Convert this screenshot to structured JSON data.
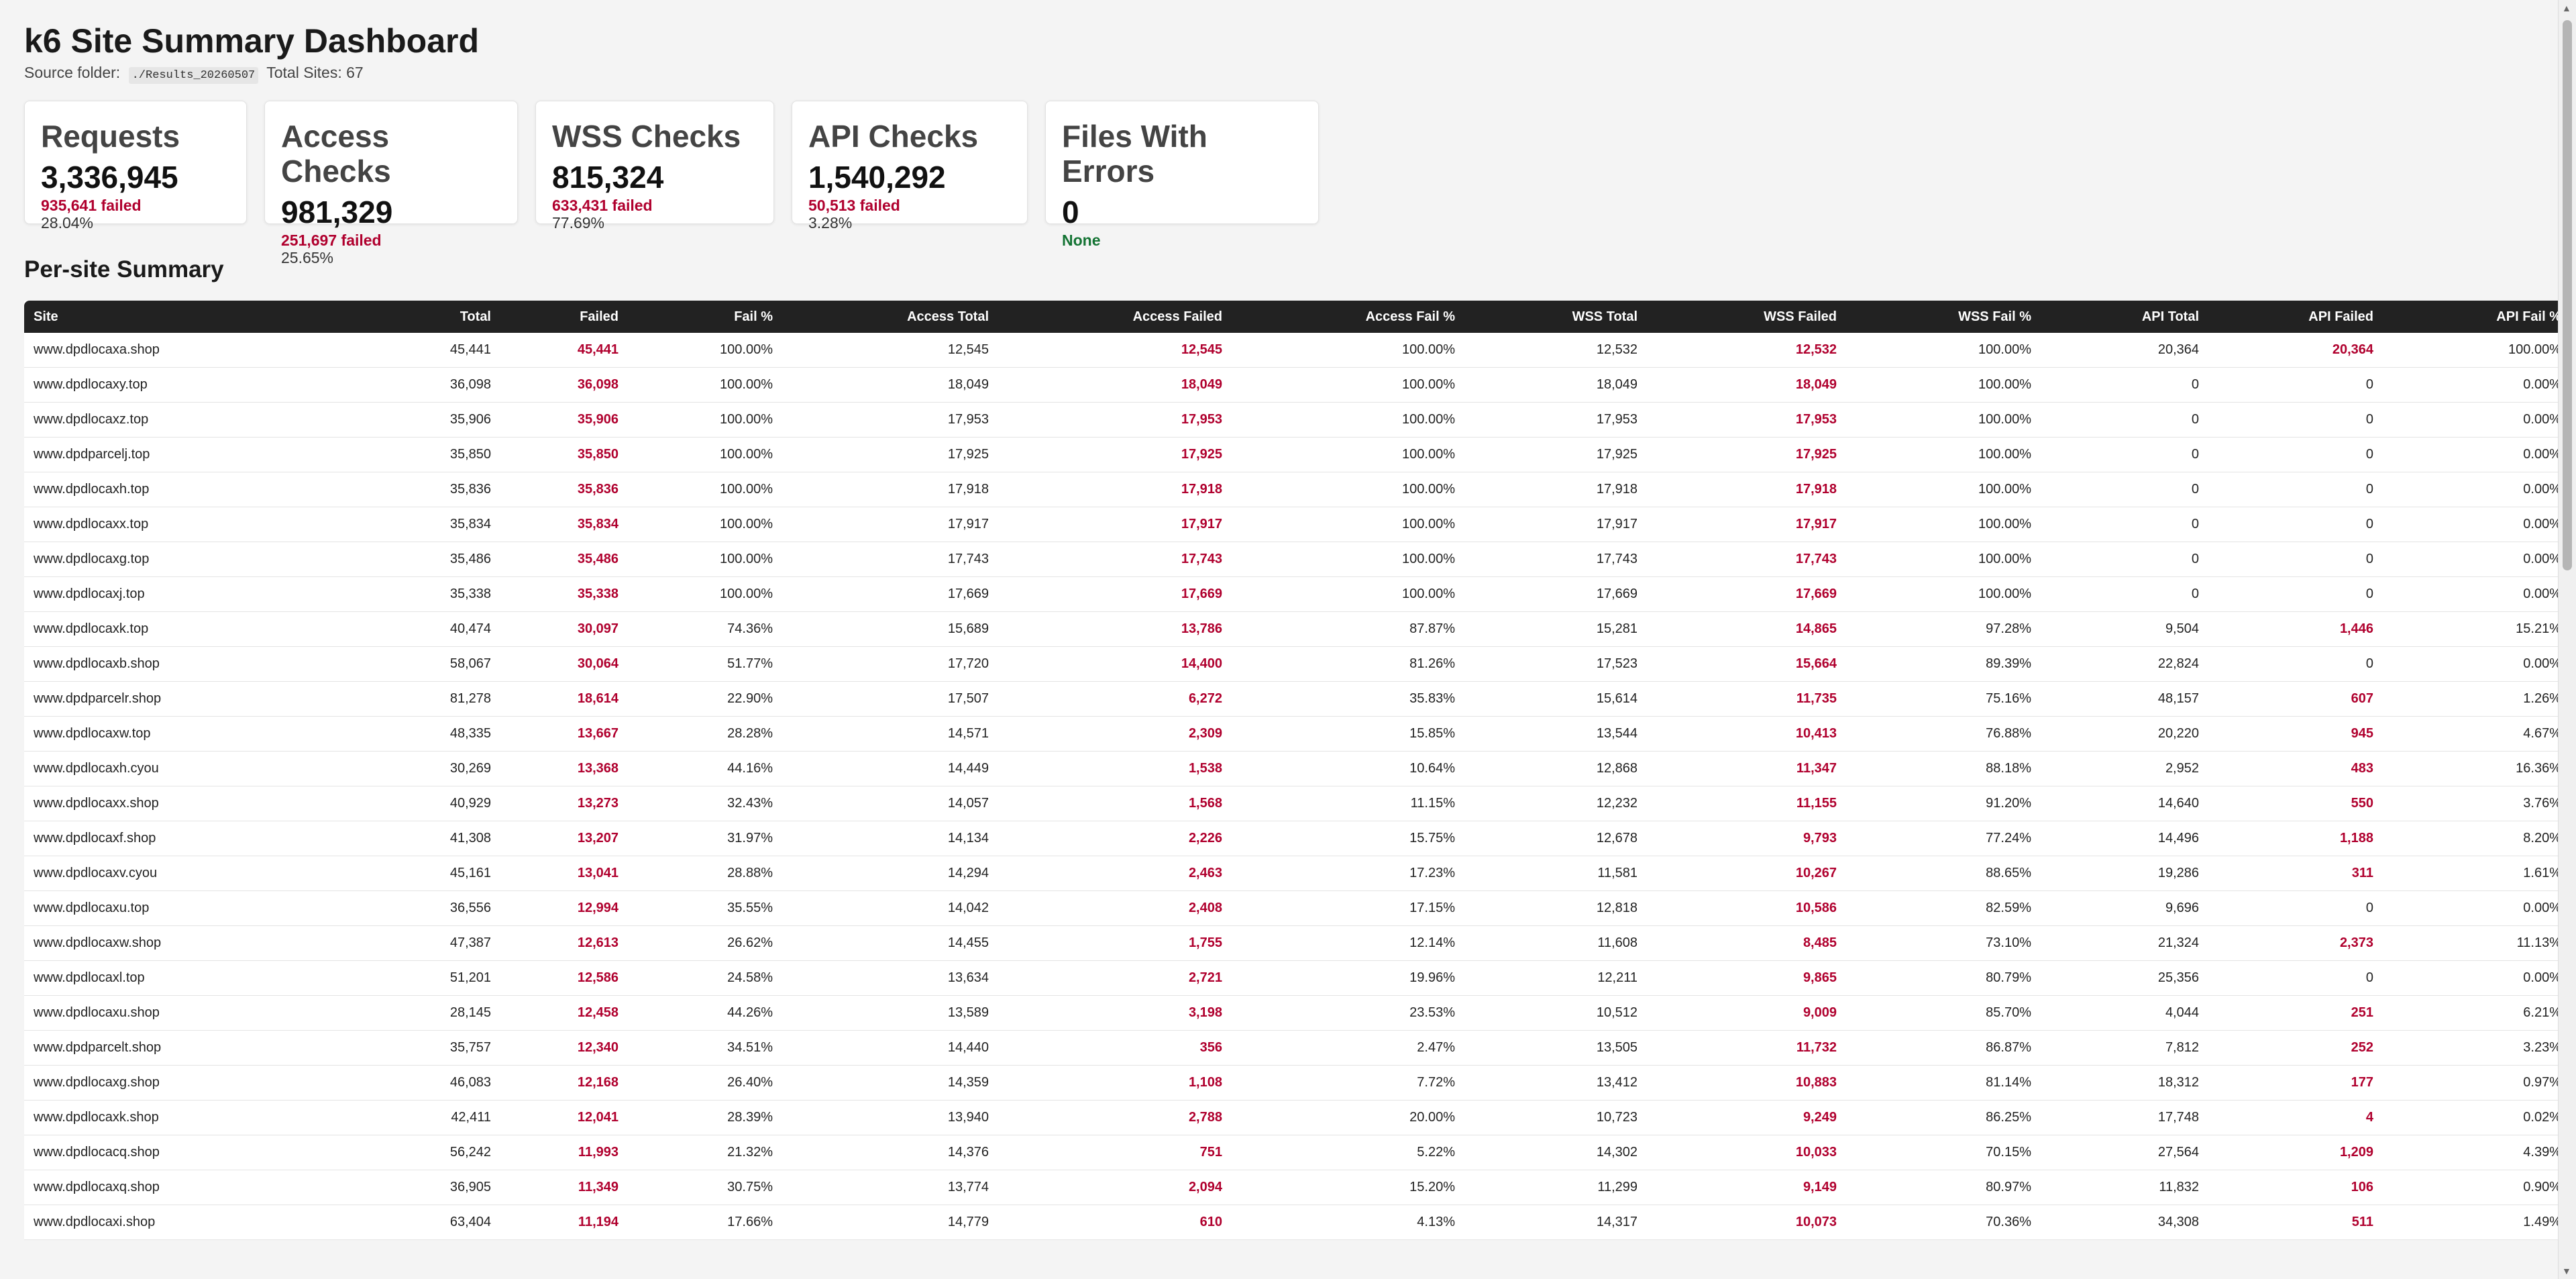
{
  "header": {
    "title": "k6 Site Summary Dashboard",
    "source_label": "Source folder:",
    "source_path": "./Results_20260507",
    "total_sites": "Total Sites: 67"
  },
  "cards": {
    "requests": {
      "title": "Requests",
      "value": "3,336,945",
      "failed": "935,641 failed",
      "pct": "28.04%"
    },
    "access": {
      "title": "Access Checks",
      "value": "981,329",
      "failed": "251,697 failed",
      "pct": "25.65%"
    },
    "wss": {
      "title": "WSS Checks",
      "value": "815,324",
      "failed": "633,431 failed",
      "pct": "77.69%"
    },
    "api": {
      "title": "API Checks",
      "value": "1,540,292",
      "failed": "50,513 failed",
      "pct": "3.28%"
    },
    "errors": {
      "title": "Files With Errors",
      "value": "0",
      "status": "None"
    }
  },
  "section_title": "Per-site Summary",
  "colors": {
    "fail": "#b0002e",
    "ok": "#137333",
    "header_bg": "#222222"
  },
  "table": {
    "headers": [
      "Site",
      "Total",
      "Failed",
      "Fail %",
      "Access Total",
      "Access Failed",
      "Access Fail %",
      "WSS Total",
      "WSS Failed",
      "WSS Fail %",
      "API Total",
      "API Failed",
      "API Fail %"
    ],
    "rows": [
      [
        "www.dpdlocaxa.shop",
        "45,441",
        "45,441",
        "100.00%",
        "12,545",
        "12,545",
        "100.00%",
        "12,532",
        "12,532",
        "100.00%",
        "20,364",
        "20,364",
        "100.00%"
      ],
      [
        "www.dpdlocaxy.top",
        "36,098",
        "36,098",
        "100.00%",
        "18,049",
        "18,049",
        "100.00%",
        "18,049",
        "18,049",
        "100.00%",
        "0",
        "0",
        "0.00%"
      ],
      [
        "www.dpdlocaxz.top",
        "35,906",
        "35,906",
        "100.00%",
        "17,953",
        "17,953",
        "100.00%",
        "17,953",
        "17,953",
        "100.00%",
        "0",
        "0",
        "0.00%"
      ],
      [
        "www.dpdparcelj.top",
        "35,850",
        "35,850",
        "100.00%",
        "17,925",
        "17,925",
        "100.00%",
        "17,925",
        "17,925",
        "100.00%",
        "0",
        "0",
        "0.00%"
      ],
      [
        "www.dpdlocaxh.top",
        "35,836",
        "35,836",
        "100.00%",
        "17,918",
        "17,918",
        "100.00%",
        "17,918",
        "17,918",
        "100.00%",
        "0",
        "0",
        "0.00%"
      ],
      [
        "www.dpdlocaxx.top",
        "35,834",
        "35,834",
        "100.00%",
        "17,917",
        "17,917",
        "100.00%",
        "17,917",
        "17,917",
        "100.00%",
        "0",
        "0",
        "0.00%"
      ],
      [
        "www.dpdlocaxg.top",
        "35,486",
        "35,486",
        "100.00%",
        "17,743",
        "17,743",
        "100.00%",
        "17,743",
        "17,743",
        "100.00%",
        "0",
        "0",
        "0.00%"
      ],
      [
        "www.dpdlocaxj.top",
        "35,338",
        "35,338",
        "100.00%",
        "17,669",
        "17,669",
        "100.00%",
        "17,669",
        "17,669",
        "100.00%",
        "0",
        "0",
        "0.00%"
      ],
      [
        "www.dpdlocaxk.top",
        "40,474",
        "30,097",
        "74.36%",
        "15,689",
        "13,786",
        "87.87%",
        "15,281",
        "14,865",
        "97.28%",
        "9,504",
        "1,446",
        "15.21%"
      ],
      [
        "www.dpdlocaxb.shop",
        "58,067",
        "30,064",
        "51.77%",
        "17,720",
        "14,400",
        "81.26%",
        "17,523",
        "15,664",
        "89.39%",
        "22,824",
        "0",
        "0.00%"
      ],
      [
        "www.dpdparcelr.shop",
        "81,278",
        "18,614",
        "22.90%",
        "17,507",
        "6,272",
        "35.83%",
        "15,614",
        "11,735",
        "75.16%",
        "48,157",
        "607",
        "1.26%"
      ],
      [
        "www.dpdlocaxw.top",
        "48,335",
        "13,667",
        "28.28%",
        "14,571",
        "2,309",
        "15.85%",
        "13,544",
        "10,413",
        "76.88%",
        "20,220",
        "945",
        "4.67%"
      ],
      [
        "www.dpdlocaxh.cyou",
        "30,269",
        "13,368",
        "44.16%",
        "14,449",
        "1,538",
        "10.64%",
        "12,868",
        "11,347",
        "88.18%",
        "2,952",
        "483",
        "16.36%"
      ],
      [
        "www.dpdlocaxx.shop",
        "40,929",
        "13,273",
        "32.43%",
        "14,057",
        "1,568",
        "11.15%",
        "12,232",
        "11,155",
        "91.20%",
        "14,640",
        "550",
        "3.76%"
      ],
      [
        "www.dpdlocaxf.shop",
        "41,308",
        "13,207",
        "31.97%",
        "14,134",
        "2,226",
        "15.75%",
        "12,678",
        "9,793",
        "77.24%",
        "14,496",
        "1,188",
        "8.20%"
      ],
      [
        "www.dpdlocaxv.cyou",
        "45,161",
        "13,041",
        "28.88%",
        "14,294",
        "2,463",
        "17.23%",
        "11,581",
        "10,267",
        "88.65%",
        "19,286",
        "311",
        "1.61%"
      ],
      [
        "www.dpdlocaxu.top",
        "36,556",
        "12,994",
        "35.55%",
        "14,042",
        "2,408",
        "17.15%",
        "12,818",
        "10,586",
        "82.59%",
        "9,696",
        "0",
        "0.00%"
      ],
      [
        "www.dpdlocaxw.shop",
        "47,387",
        "12,613",
        "26.62%",
        "14,455",
        "1,755",
        "12.14%",
        "11,608",
        "8,485",
        "73.10%",
        "21,324",
        "2,373",
        "11.13%"
      ],
      [
        "www.dpdlocaxl.top",
        "51,201",
        "12,586",
        "24.58%",
        "13,634",
        "2,721",
        "19.96%",
        "12,211",
        "9,865",
        "80.79%",
        "25,356",
        "0",
        "0.00%"
      ],
      [
        "www.dpdlocaxu.shop",
        "28,145",
        "12,458",
        "44.26%",
        "13,589",
        "3,198",
        "23.53%",
        "10,512",
        "9,009",
        "85.70%",
        "4,044",
        "251",
        "6.21%"
      ],
      [
        "www.dpdparcelt.shop",
        "35,757",
        "12,340",
        "34.51%",
        "14,440",
        "356",
        "2.47%",
        "13,505",
        "11,732",
        "86.87%",
        "7,812",
        "252",
        "3.23%"
      ],
      [
        "www.dpdlocaxg.shop",
        "46,083",
        "12,168",
        "26.40%",
        "14,359",
        "1,108",
        "7.72%",
        "13,412",
        "10,883",
        "81.14%",
        "18,312",
        "177",
        "0.97%"
      ],
      [
        "www.dpdlocaxk.shop",
        "42,411",
        "12,041",
        "28.39%",
        "13,940",
        "2,788",
        "20.00%",
        "10,723",
        "9,249",
        "86.25%",
        "17,748",
        "4",
        "0.02%"
      ],
      [
        "www.dpdlocacq.shop",
        "56,242",
        "11,993",
        "21.32%",
        "14,376",
        "751",
        "5.22%",
        "14,302",
        "10,033",
        "70.15%",
        "27,564",
        "1,209",
        "4.39%"
      ],
      [
        "www.dpdlocaxq.shop",
        "36,905",
        "11,349",
        "30.75%",
        "13,774",
        "2,094",
        "15.20%",
        "11,299",
        "9,149",
        "80.97%",
        "11,832",
        "106",
        "0.90%"
      ],
      [
        "www.dpdlocaxi.shop",
        "63,404",
        "11,194",
        "17.66%",
        "14,779",
        "610",
        "4.13%",
        "14,317",
        "10,073",
        "70.36%",
        "34,308",
        "511",
        "1.49%"
      ]
    ]
  }
}
